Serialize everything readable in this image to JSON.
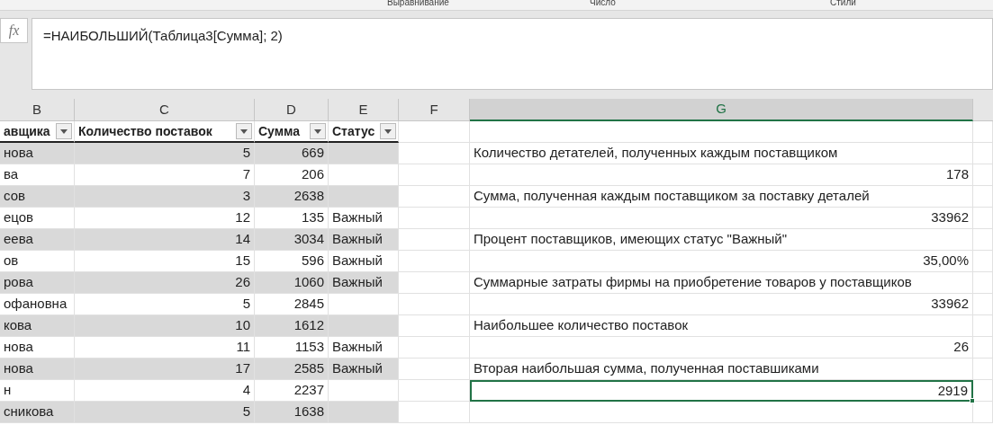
{
  "ribbon_groups": [
    "Выравнивание",
    "Число",
    "Стили"
  ],
  "formula_bar": {
    "fx": "fx",
    "formula": "=НАИБОЛЬШИЙ(Таблица3[Сумма]; 2)"
  },
  "columns": [
    {
      "letter": "B",
      "selected": false
    },
    {
      "letter": "C",
      "selected": false
    },
    {
      "letter": "D",
      "selected": false
    },
    {
      "letter": "E",
      "selected": false
    },
    {
      "letter": "F",
      "selected": false
    },
    {
      "letter": "G",
      "selected": true
    }
  ],
  "table": {
    "headers": [
      "авщика",
      "Количество поставок",
      "Сумма",
      "Статус"
    ],
    "rows": [
      [
        "нова",
        "5",
        "669",
        ""
      ],
      [
        "ва",
        "7",
        "206",
        ""
      ],
      [
        "сов",
        "3",
        "2638",
        ""
      ],
      [
        "ецов",
        "12",
        "135",
        "Важный"
      ],
      [
        "еева",
        "14",
        "3034",
        "Важный"
      ],
      [
        "ов",
        "15",
        "596",
        "Важный"
      ],
      [
        "рова",
        "26",
        "1060",
        "Важный"
      ],
      [
        "офановна",
        "5",
        "2845",
        ""
      ],
      [
        "кова",
        "10",
        "1612",
        ""
      ],
      [
        "нова",
        "11",
        "1153",
        "Важный"
      ],
      [
        "нова",
        "17",
        "2585",
        "Важный"
      ],
      [
        "н",
        "4",
        "2237",
        ""
      ],
      [
        "сникова",
        "5",
        "1638",
        ""
      ]
    ]
  },
  "column_g": [
    {
      "kind": "empty",
      "selected": false
    },
    {
      "kind": "label",
      "text": "Количество детателей, полученных каждым поставщиком",
      "selected": false
    },
    {
      "kind": "value",
      "text": "178",
      "selected": false
    },
    {
      "kind": "label",
      "text": "Сумма, полученная каждым поставщиком за поставку деталей",
      "selected": false
    },
    {
      "kind": "value",
      "text": "33962",
      "selected": false
    },
    {
      "kind": "label",
      "text": "Процент поставщиков, имеющих статус \"Важный\"",
      "selected": false
    },
    {
      "kind": "value",
      "text": "35,00%",
      "selected": false
    },
    {
      "kind": "label",
      "text": "Суммарные затраты фирмы на приобретение товаров у поставщиков",
      "selected": false
    },
    {
      "kind": "value",
      "text": "33962",
      "selected": false
    },
    {
      "kind": "label",
      "text": "Наибольшее количество поставок",
      "selected": false
    },
    {
      "kind": "value",
      "text": "26",
      "selected": false
    },
    {
      "kind": "label",
      "text": "Вторая наибольшая сумма, полученная поставшиками",
      "selected": false
    },
    {
      "kind": "value",
      "text": "2919",
      "selected": true
    },
    {
      "kind": "empty",
      "selected": false
    }
  ]
}
